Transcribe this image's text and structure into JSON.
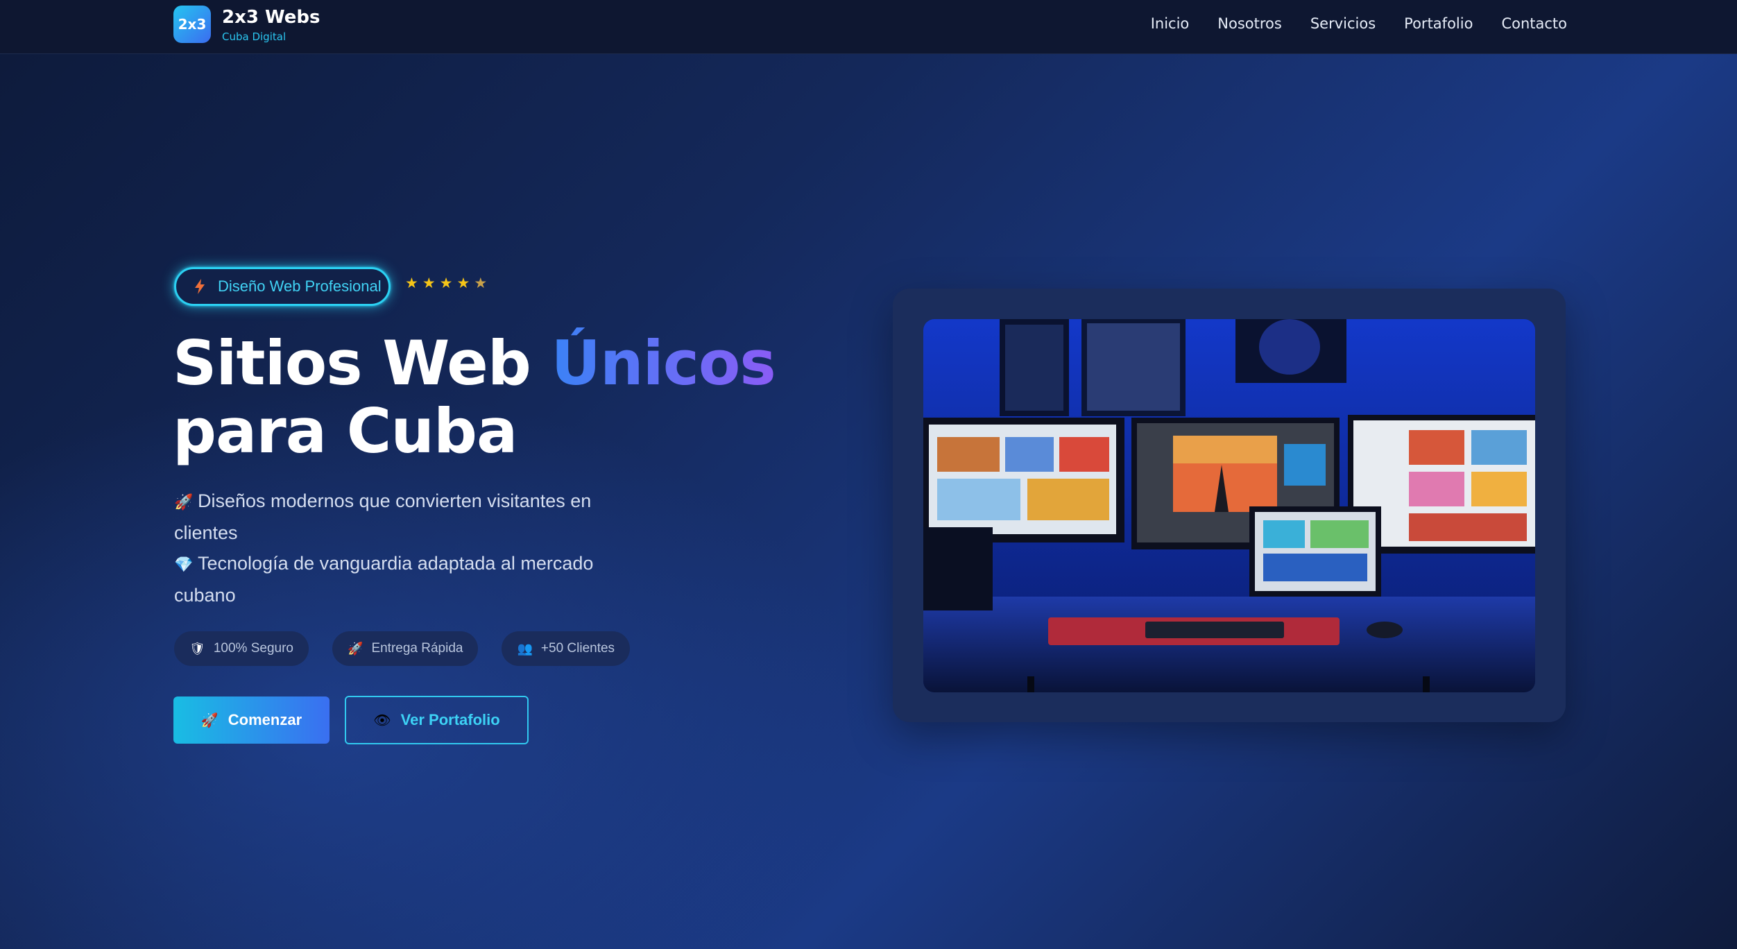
{
  "nav": {
    "logo_text": "2x3",
    "brand_name": "2x3 Webs",
    "brand_sub": "Cuba Digital",
    "links": [
      "Inicio",
      "Nosotros",
      "Servicios",
      "Portafolio",
      "Contacto"
    ]
  },
  "hero": {
    "badge": {
      "icon": "lightning-icon",
      "label": "Diseño Web Profesional"
    },
    "rating": 5,
    "title_line1_white": "Sitios Web",
    "title_line1_accent": "Únicos",
    "title_line2": "para Cuba",
    "bullets": [
      {
        "icon": "rocket-icon",
        "glyph": "🚀",
        "text": "Diseños modernos que convierten visitantes en clientes"
      },
      {
        "icon": "diamond-icon",
        "glyph": "💎",
        "text": "Tecnología de vanguardia adaptada al mercado cubano"
      }
    ],
    "chips": [
      {
        "icon": "shield-icon",
        "glyph": "🛡",
        "label": "100% Seguro"
      },
      {
        "icon": "rocket-icon",
        "glyph": "🚀",
        "label": "Entrega Rápida"
      },
      {
        "icon": "people-icon",
        "glyph": "👥",
        "label": "+50 Clientes"
      }
    ],
    "primary_button": {
      "icon": "rocket-icon",
      "glyph": "🚀",
      "label": "Comenzar"
    },
    "secondary_button": {
      "icon": "eye-icon",
      "glyph": "👁",
      "label": "Ver Portafolio"
    }
  },
  "hero_image": {
    "description_icon": "workstation-image"
  },
  "colors": {
    "accent_cyan": "#2bd0f2",
    "accent_blue": "#3b82f6",
    "accent_violet": "#8b5cf6",
    "nav_bg": "#0e1731",
    "star": "#f5c518"
  }
}
